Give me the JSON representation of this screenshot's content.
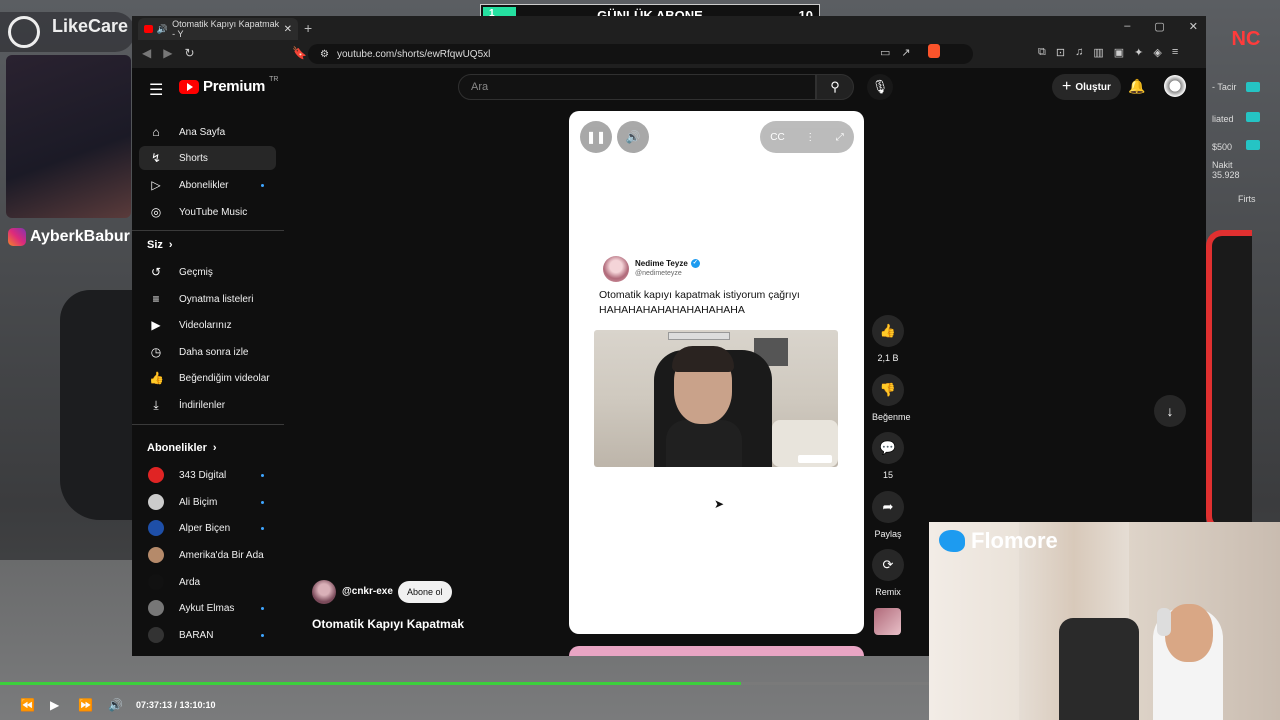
{
  "overlay": {
    "likecare_label": "LikeCare",
    "instagram_handle": "AyberkBabur",
    "abone_counter": {
      "left": "1",
      "title": "GÜNLÜK ABONE",
      "right": "10",
      "progress": 0.1
    },
    "webcam_twitter_handle": "Flomore",
    "hud_logo": "NC",
    "hud_lines": [
      "- Tacir",
      "liated",
      "$500",
      "Nakit",
      "35.928",
      "Firts"
    ]
  },
  "browser": {
    "tab_title": "Otomatik Kapıyı Kapatmak - Y",
    "url": "youtube.com/shorts/ewRfqwUQ5xl",
    "new_tab": "+",
    "window_controls": [
      "–",
      "▢",
      "✕"
    ]
  },
  "youtube": {
    "logo_text": "Premium",
    "logo_region": "TR",
    "search_placeholder": "Ara",
    "create_label": "Oluştur",
    "sidebar": {
      "main": [
        {
          "label": "Ana Sayfa",
          "icon": "home-icon"
        },
        {
          "label": "Shorts",
          "icon": "shorts-icon",
          "active": true
        },
        {
          "label": "Abonelikler",
          "icon": "subscriptions-icon",
          "dot": true
        },
        {
          "label": "YouTube Music",
          "icon": "music-icon"
        }
      ],
      "you_header": "Siz",
      "you": [
        {
          "label": "Geçmiş",
          "icon": "history-icon"
        },
        {
          "label": "Oynatma listeleri",
          "icon": "playlist-icon"
        },
        {
          "label": "Videolarınız",
          "icon": "your-videos-icon"
        },
        {
          "label": "Daha sonra izle",
          "icon": "watch-later-icon"
        },
        {
          "label": "Beğendiğim videolar",
          "icon": "liked-icon"
        },
        {
          "label": "İndirilenler",
          "icon": "download-icon"
        }
      ],
      "subs_header": "Abonelikler",
      "subs": [
        {
          "label": "343 Digital",
          "color": "#e02424"
        },
        {
          "label": "Ali Biçim",
          "color": "#cccccc"
        },
        {
          "label": "Alper Biçen",
          "color": "#1e4fa8"
        },
        {
          "label": "Amerika'da Bir Ada",
          "color": "#b58a6a"
        },
        {
          "label": "Arda",
          "color": "#111111"
        },
        {
          "label": "Aykut Elmas",
          "color": "#777777"
        },
        {
          "label": "BARAN",
          "color": "#333333"
        }
      ]
    },
    "short": {
      "tweet_name": "Nedime Teyze",
      "tweet_handle": "@nedimeteyze",
      "tweet_line1": "Otomatik kapıyı kapatmak istiyorum çağrıyı",
      "tweet_line2": "HAHAHAHAHAHAHAHAHAHA",
      "channel": "@cnkr-exe",
      "subscribe_label": "Abone ol",
      "title": "Otomatik Kapıyı Kapatmak",
      "cc_label": "CC"
    },
    "actions": {
      "likes": "2,1 B",
      "dislike_label": "Beğenme",
      "comments": "15",
      "share_label": "Paylaş",
      "remix_label": "Remix"
    }
  },
  "player": {
    "time_display": "07:37:13 / 13:10:10",
    "progress": 0.788
  }
}
